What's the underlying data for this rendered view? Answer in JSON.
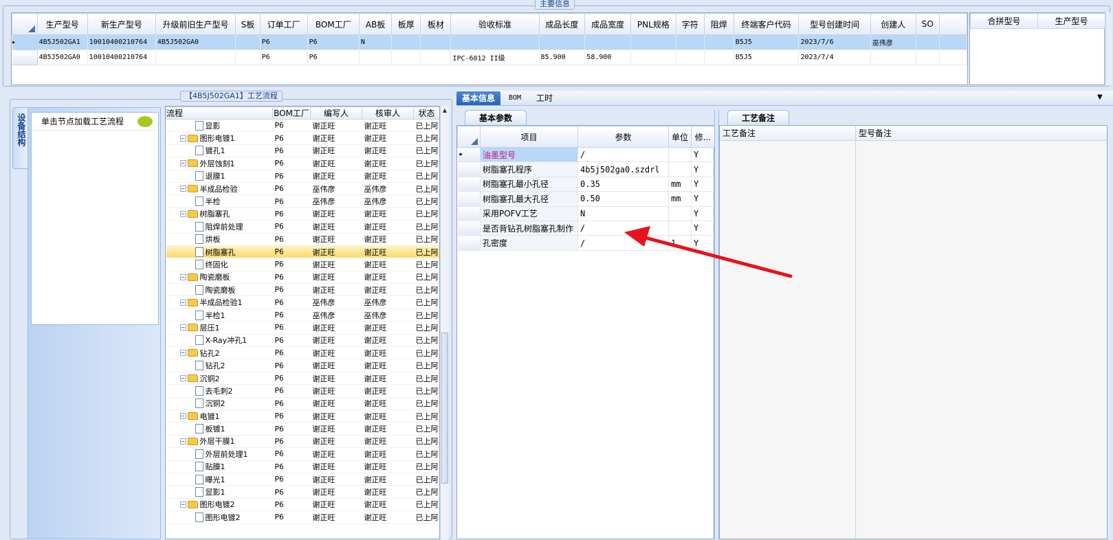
{
  "main_info_title": "主要信息",
  "top_table": {
    "headers": [
      "生产型号",
      "新生产型号",
      "升级前旧生产型号",
      "S板",
      "订单工厂",
      "BOM工厂",
      "AB板",
      "板厚",
      "板材",
      "验收标准",
      "成品长度",
      "成品宽度",
      "PNL规格",
      "字符",
      "阻焊",
      "终端客户代码",
      "型号创建时间",
      "创建人",
      "SO"
    ],
    "rows": [
      [
        "4B5J502GA1",
        "10010400210764",
        "4B5J502GA0",
        "",
        "P6",
        "P6",
        "N",
        "",
        "",
        "",
        "",
        "",
        "",
        "",
        "",
        "B5J5",
        "2023/7/6",
        "巫伟彦",
        ""
      ],
      [
        "4B5J502GA0",
        "10010400210764",
        "",
        "",
        "P6",
        "P6",
        "",
        "",
        "",
        "IPC-6012 II级",
        "85.900",
        "58.900",
        "",
        "",
        "",
        "B5J5",
        "2023/7/4",
        "",
        ""
      ]
    ]
  },
  "merge_headers": [
    "合拼型号",
    "生产型号"
  ],
  "process_title": "【4B5J502GA1】工艺流程",
  "side_tab_label": "设备结构",
  "left_prompt": "单击节点加载工艺流程",
  "tree": {
    "headers": [
      "流程",
      "BOM工厂",
      "编写人",
      "核审人",
      "状态"
    ],
    "rows": [
      {
        "name": "显影",
        "folder": false,
        "bom": "P6",
        "writer": "谢正旺",
        "reviewer": "谢正旺",
        "status": "已上阿"
      },
      {
        "name": "图形电镀1",
        "folder": true,
        "bom": "P6",
        "writer": "谢正旺",
        "reviewer": "谢正旺",
        "status": "已上阿"
      },
      {
        "name": "镀孔1",
        "folder": false,
        "bom": "P6",
        "writer": "谢正旺",
        "reviewer": "谢正旺",
        "status": "已上阿"
      },
      {
        "name": "外层蚀刻1",
        "folder": true,
        "bom": "P6",
        "writer": "谢正旺",
        "reviewer": "谢正旺",
        "status": "已上阿"
      },
      {
        "name": "退膜1",
        "folder": false,
        "bom": "P6",
        "writer": "谢正旺",
        "reviewer": "谢正旺",
        "status": "已上阿"
      },
      {
        "name": "半成品检验",
        "folder": true,
        "bom": "P6",
        "writer": "巫伟彦",
        "reviewer": "巫伟彦",
        "status": "已上阿"
      },
      {
        "name": "半检",
        "folder": false,
        "bom": "P6",
        "writer": "巫伟彦",
        "reviewer": "巫伟彦",
        "status": "已上阿"
      },
      {
        "name": "树脂塞孔",
        "folder": true,
        "bom": "P6",
        "writer": "谢正旺",
        "reviewer": "谢正旺",
        "status": "已上阿"
      },
      {
        "name": "阻焊前处理",
        "folder": false,
        "bom": "P6",
        "writer": "谢正旺",
        "reviewer": "谢正旺",
        "status": "已上阿"
      },
      {
        "name": "烘板",
        "folder": false,
        "bom": "P6",
        "writer": "谢正旺",
        "reviewer": "谢正旺",
        "status": "已上阿"
      },
      {
        "name": "树脂塞孔",
        "folder": false,
        "bom": "P6",
        "writer": "谢正旺",
        "reviewer": "谢正旺",
        "status": "已上阿",
        "selected": true
      },
      {
        "name": "终固化",
        "folder": false,
        "bom": "P6",
        "writer": "谢正旺",
        "reviewer": "谢正旺",
        "status": "已上阿"
      },
      {
        "name": "陶瓷磨板",
        "folder": true,
        "bom": "P6",
        "writer": "谢正旺",
        "reviewer": "谢正旺",
        "status": "已上阿"
      },
      {
        "name": "陶瓷磨板",
        "folder": false,
        "bom": "P6",
        "writer": "谢正旺",
        "reviewer": "谢正旺",
        "status": "已上阿"
      },
      {
        "name": "半成品检验1",
        "folder": true,
        "bom": "P6",
        "writer": "巫伟彦",
        "reviewer": "巫伟彦",
        "status": "已上阿"
      },
      {
        "name": "半检1",
        "folder": false,
        "bom": "P6",
        "writer": "巫伟彦",
        "reviewer": "巫伟彦",
        "status": "已上阿"
      },
      {
        "name": "层压1",
        "folder": true,
        "bom": "P6",
        "writer": "谢正旺",
        "reviewer": "谢正旺",
        "status": "已上阿"
      },
      {
        "name": "X-Ray冲孔1",
        "folder": false,
        "bom": "P6",
        "writer": "谢正旺",
        "reviewer": "谢正旺",
        "status": "已上阿"
      },
      {
        "name": "钻孔2",
        "folder": true,
        "bom": "P6",
        "writer": "谢正旺",
        "reviewer": "谢正旺",
        "status": "已上阿"
      },
      {
        "name": "钻孔2",
        "folder": false,
        "bom": "P6",
        "writer": "谢正旺",
        "reviewer": "谢正旺",
        "status": "已上阿"
      },
      {
        "name": "沉铜2",
        "folder": true,
        "bom": "P6",
        "writer": "谢正旺",
        "reviewer": "谢正旺",
        "status": "已上阿"
      },
      {
        "name": "去毛刺2",
        "folder": false,
        "bom": "P6",
        "writer": "谢正旺",
        "reviewer": "谢正旺",
        "status": "已上阿"
      },
      {
        "name": "沉铜2",
        "folder": false,
        "bom": "P6",
        "writer": "谢正旺",
        "reviewer": "谢正旺",
        "status": "已上阿"
      },
      {
        "name": "电镀1",
        "folder": true,
        "bom": "P6",
        "writer": "谢正旺",
        "reviewer": "谢正旺",
        "status": "已上阿"
      },
      {
        "name": "板镀1",
        "folder": false,
        "bom": "P6",
        "writer": "谢正旺",
        "reviewer": "谢正旺",
        "status": "已上阿"
      },
      {
        "name": "外层干膜1",
        "folder": true,
        "bom": "P6",
        "writer": "谢正旺",
        "reviewer": "谢正旺",
        "status": "已上阿"
      },
      {
        "name": "外层前处理1",
        "folder": false,
        "bom": "P6",
        "writer": "谢正旺",
        "reviewer": "谢正旺",
        "status": "已上阿"
      },
      {
        "name": "贴膜1",
        "folder": false,
        "bom": "P6",
        "writer": "谢正旺",
        "reviewer": "谢正旺",
        "status": "已上阿"
      },
      {
        "name": "曝光1",
        "folder": false,
        "bom": "P6",
        "writer": "谢正旺",
        "reviewer": "谢正旺",
        "status": "已上阿"
      },
      {
        "name": "显影1",
        "folder": false,
        "bom": "P6",
        "writer": "谢正旺",
        "reviewer": "谢正旺",
        "status": "已上阿"
      },
      {
        "name": "图形电镀2",
        "folder": true,
        "bom": "P6",
        "writer": "谢正旺",
        "reviewer": "谢正旺",
        "status": "已上阿"
      },
      {
        "name": "图形电镀2",
        "folder": false,
        "bom": "P6",
        "writer": "谢正旺",
        "reviewer": "谢正旺",
        "status": "已上阿"
      }
    ]
  },
  "tabs": {
    "basic": "基本信息",
    "bom": "BOM",
    "hours": "工时"
  },
  "basic_params_tab": "基本参数",
  "params": {
    "headers": [
      "项目",
      "参数",
      "单位",
      "修..."
    ],
    "rows": [
      {
        "item": "油墨型号",
        "value": "/",
        "unit": "",
        "flag": "Y",
        "highlight": true
      },
      {
        "item": "树脂塞孔程序",
        "value": "4b5j502ga0.szdrl",
        "unit": "",
        "flag": "Y"
      },
      {
        "item": "树脂塞孔最小孔径",
        "value": "0.35",
        "unit": "mm",
        "flag": "Y"
      },
      {
        "item": "树脂塞孔最大孔径",
        "value": "0.50",
        "unit": "mm",
        "flag": "Y"
      },
      {
        "item": "采用POFV工艺",
        "value": "N",
        "unit": "",
        "flag": "Y"
      },
      {
        "item": "是否背钻孔树脂塞孔制作",
        "value": "/",
        "unit": "",
        "flag": "Y"
      },
      {
        "item": "孔密度",
        "value": "/",
        "unit": "1.",
        "flag": "Y"
      }
    ]
  },
  "remark_tab": "工艺备注",
  "remark_headers": [
    "工艺备注",
    "型号备注"
  ],
  "colors": {
    "accent": "#2a62b4",
    "select": "#b9d7f7",
    "highlight_text": "#c71585",
    "arrow": "#e8121e"
  }
}
